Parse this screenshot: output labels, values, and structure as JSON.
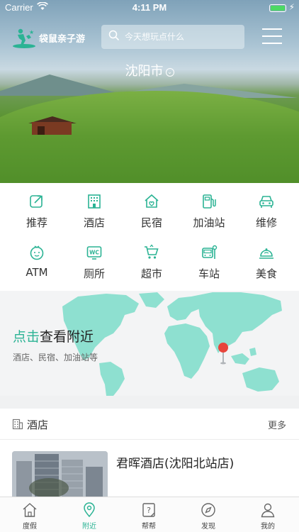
{
  "status_bar": {
    "carrier": "Carrier",
    "time": "4:11 PM"
  },
  "header": {
    "logo_text": "袋鼠亲子游",
    "search_placeholder": "今天想玩点什么",
    "city": "沈阳市"
  },
  "categories": [
    {
      "label": "推荐",
      "icon": "recommend-icon"
    },
    {
      "label": "酒店",
      "icon": "hotel-icon"
    },
    {
      "label": "民宿",
      "icon": "homestay-icon"
    },
    {
      "label": "加油站",
      "icon": "gas-station-icon"
    },
    {
      "label": "维修",
      "icon": "car-repair-icon"
    },
    {
      "label": "ATM",
      "icon": "atm-icon"
    },
    {
      "label": "厕所",
      "icon": "toilet-icon"
    },
    {
      "label": "超市",
      "icon": "shopping-cart-icon"
    },
    {
      "label": "车站",
      "icon": "bus-station-icon"
    },
    {
      "label": "美食",
      "icon": "food-icon"
    }
  ],
  "banner": {
    "title_highlight": "点击",
    "title_rest": "查看附近",
    "subtitle": "酒店、民宿、加油站等"
  },
  "hotel_section": {
    "title": "酒店",
    "more": "更多",
    "items": [
      {
        "name": "君晖酒店(沈阳北站店)"
      }
    ]
  },
  "tabbar": [
    {
      "label": "度假",
      "icon": "home-icon",
      "active": false
    },
    {
      "label": "附近",
      "icon": "location-pin-icon",
      "active": true
    },
    {
      "label": "帮帮",
      "icon": "question-note-icon",
      "active": false
    },
    {
      "label": "发现",
      "icon": "compass-icon",
      "active": false
    },
    {
      "label": "我的",
      "icon": "user-icon",
      "active": false
    }
  ],
  "colors": {
    "accent": "#2bb394",
    "map": "#8ee0d0",
    "pin": "#e8453c"
  }
}
